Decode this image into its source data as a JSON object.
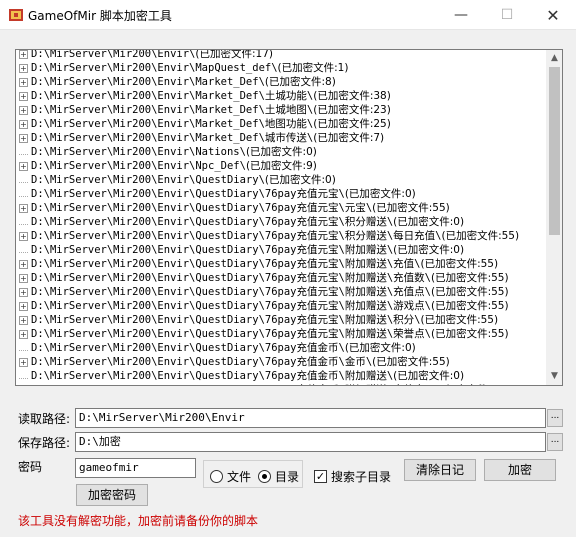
{
  "window": {
    "title": "GameOfMir 脚本加密工具",
    "minimize_glyph": "—",
    "maximize_glyph": "☐",
    "close_glyph": "✕"
  },
  "icons": {
    "app": "app-logo-icon",
    "expand": "plus-expander-icon",
    "browse": "ellipsis-icon"
  },
  "tree": {
    "rows": [
      {
        "expandable": true,
        "path": "D:\\MirServer\\Mir200\\Envir\\",
        "count": "(已加密文件:17)"
      },
      {
        "expandable": true,
        "path": "D:\\MirServer\\Mir200\\Envir\\MapQuest_def\\",
        "count": "(已加密文件:1)"
      },
      {
        "expandable": true,
        "path": "D:\\MirServer\\Mir200\\Envir\\Market_Def\\",
        "count": "(已加密文件:8)"
      },
      {
        "expandable": true,
        "path": "D:\\MirServer\\Mir200\\Envir\\Market_Def\\土城功能\\",
        "count": "(已加密文件:38)"
      },
      {
        "expandable": true,
        "path": "D:\\MirServer\\Mir200\\Envir\\Market_Def\\土城地图\\",
        "count": "(已加密文件:23)"
      },
      {
        "expandable": true,
        "path": "D:\\MirServer\\Mir200\\Envir\\Market_Def\\地图功能\\",
        "count": "(已加密文件:25)"
      },
      {
        "expandable": true,
        "path": "D:\\MirServer\\Mir200\\Envir\\Market_Def\\城市传送\\",
        "count": "(已加密文件:7)"
      },
      {
        "expandable": false,
        "path": "D:\\MirServer\\Mir200\\Envir\\Nations\\",
        "count": "(已加密文件:0)"
      },
      {
        "expandable": true,
        "path": "D:\\MirServer\\Mir200\\Envir\\Npc_Def\\",
        "count": "(已加密文件:9)"
      },
      {
        "expandable": false,
        "path": "D:\\MirServer\\Mir200\\Envir\\QuestDiary\\",
        "count": "(已加密文件:0)"
      },
      {
        "expandable": false,
        "path": "D:\\MirServer\\Mir200\\Envir\\QuestDiary\\76pay充值元宝\\",
        "count": "(已加密文件:0)"
      },
      {
        "expandable": true,
        "path": "D:\\MirServer\\Mir200\\Envir\\QuestDiary\\76pay充值元宝\\元宝\\",
        "count": "(已加密文件:55)"
      },
      {
        "expandable": false,
        "path": "D:\\MirServer\\Mir200\\Envir\\QuestDiary\\76pay充值元宝\\积分赠送\\",
        "count": "(已加密文件:0)"
      },
      {
        "expandable": true,
        "path": "D:\\MirServer\\Mir200\\Envir\\QuestDiary\\76pay充值元宝\\积分赠送\\每日充值\\",
        "count": "(已加密文件:55)"
      },
      {
        "expandable": false,
        "path": "D:\\MirServer\\Mir200\\Envir\\QuestDiary\\76pay充值元宝\\附加赠送\\",
        "count": "(已加密文件:0)"
      },
      {
        "expandable": true,
        "path": "D:\\MirServer\\Mir200\\Envir\\QuestDiary\\76pay充值元宝\\附加赠送\\充值\\",
        "count": "(已加密文件:55)"
      },
      {
        "expandable": true,
        "path": "D:\\MirServer\\Mir200\\Envir\\QuestDiary\\76pay充值元宝\\附加赠送\\充值数\\",
        "count": "(已加密文件:55)"
      },
      {
        "expandable": true,
        "path": "D:\\MirServer\\Mir200\\Envir\\QuestDiary\\76pay充值元宝\\附加赠送\\充值点\\",
        "count": "(已加密文件:55)"
      },
      {
        "expandable": true,
        "path": "D:\\MirServer\\Mir200\\Envir\\QuestDiary\\76pay充值元宝\\附加赠送\\游戏点\\",
        "count": "(已加密文件:55)"
      },
      {
        "expandable": true,
        "path": "D:\\MirServer\\Mir200\\Envir\\QuestDiary\\76pay充值元宝\\附加赠送\\积分\\",
        "count": "(已加密文件:55)"
      },
      {
        "expandable": true,
        "path": "D:\\MirServer\\Mir200\\Envir\\QuestDiary\\76pay充值元宝\\附加赠送\\荣誉点\\",
        "count": "(已加密文件:55)"
      },
      {
        "expandable": false,
        "path": "D:\\MirServer\\Mir200\\Envir\\QuestDiary\\76pay充值金币\\",
        "count": "(已加密文件:0)"
      },
      {
        "expandable": true,
        "path": "D:\\MirServer\\Mir200\\Envir\\QuestDiary\\76pay充值金币\\金币\\",
        "count": "(已加密文件:55)"
      },
      {
        "expandable": false,
        "path": "D:\\MirServer\\Mir200\\Envir\\QuestDiary\\76pay充值金币\\附加赠送\\",
        "count": "(已加密文件:0)"
      },
      {
        "expandable": true,
        "path": "D:\\MirServer\\Mir200\\Envir\\QuestDiary\\76pay充值金币\\附加赠送\\充值点\\",
        "count": "(已加密文件:55)"
      }
    ]
  },
  "form": {
    "read_path_label": "读取路径:",
    "read_path_value": "D:\\MirServer\\Mir200\\Envir",
    "save_path_label": "保存路径:",
    "save_path_value": "D:\\加密",
    "password_label": "密码",
    "password_value": "gameofmir",
    "browse_label": "...",
    "radio_file": "文件",
    "radio_dir": "目录",
    "selected_radio": "目录",
    "checkbox_subdir": "搜索子目录",
    "checkbox_subdir_checked": true,
    "check_glyph": "✓",
    "clear_log_button": "清除日记",
    "encrypt_button": "加密",
    "encrypt_password_button": "加密密码"
  },
  "warning_text": "该工具没有解密功能，加密前请备份你的脚本",
  "colors": {
    "warning": "#cc0000",
    "scroll_thumb": "#c1c1c1"
  }
}
